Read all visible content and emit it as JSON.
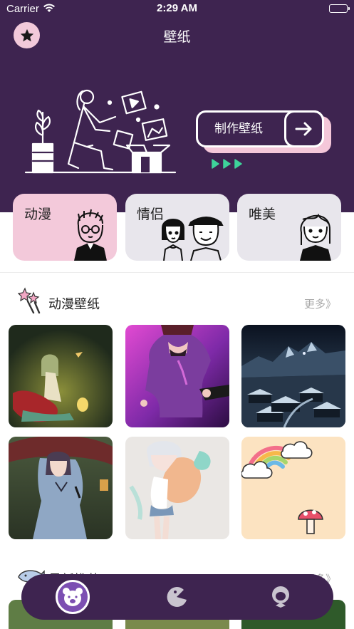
{
  "status_bar": {
    "carrier": "Carrier",
    "time": "2:29 AM"
  },
  "nav": {
    "title": "壁纸",
    "favorite_icon": "star-icon"
  },
  "hero": {
    "make_button_label": "制作壁纸",
    "arrow_icon": "arrow-right-icon"
  },
  "categories": [
    {
      "label": "动漫",
      "bg": "#f3c9da"
    },
    {
      "label": "情侣",
      "bg": "#e8e6ec"
    },
    {
      "label": "唯美",
      "bg": "#e8e6ec"
    }
  ],
  "anime_section": {
    "title": "动漫壁纸",
    "more": "更多》",
    "icon": "magic-wand-icon"
  },
  "second_section": {
    "title": "最新推荐",
    "more": "更多》",
    "icon": "whale-icon"
  },
  "tabbar": {
    "tabs": [
      "bear-icon",
      "pacman-icon",
      "person-icon"
    ],
    "active_index": 0
  },
  "colors": {
    "primary": "#3e2450",
    "accent_pink": "#f3c9da",
    "active_tab": "#7c4fb2",
    "play_green": "#3ed39a"
  }
}
